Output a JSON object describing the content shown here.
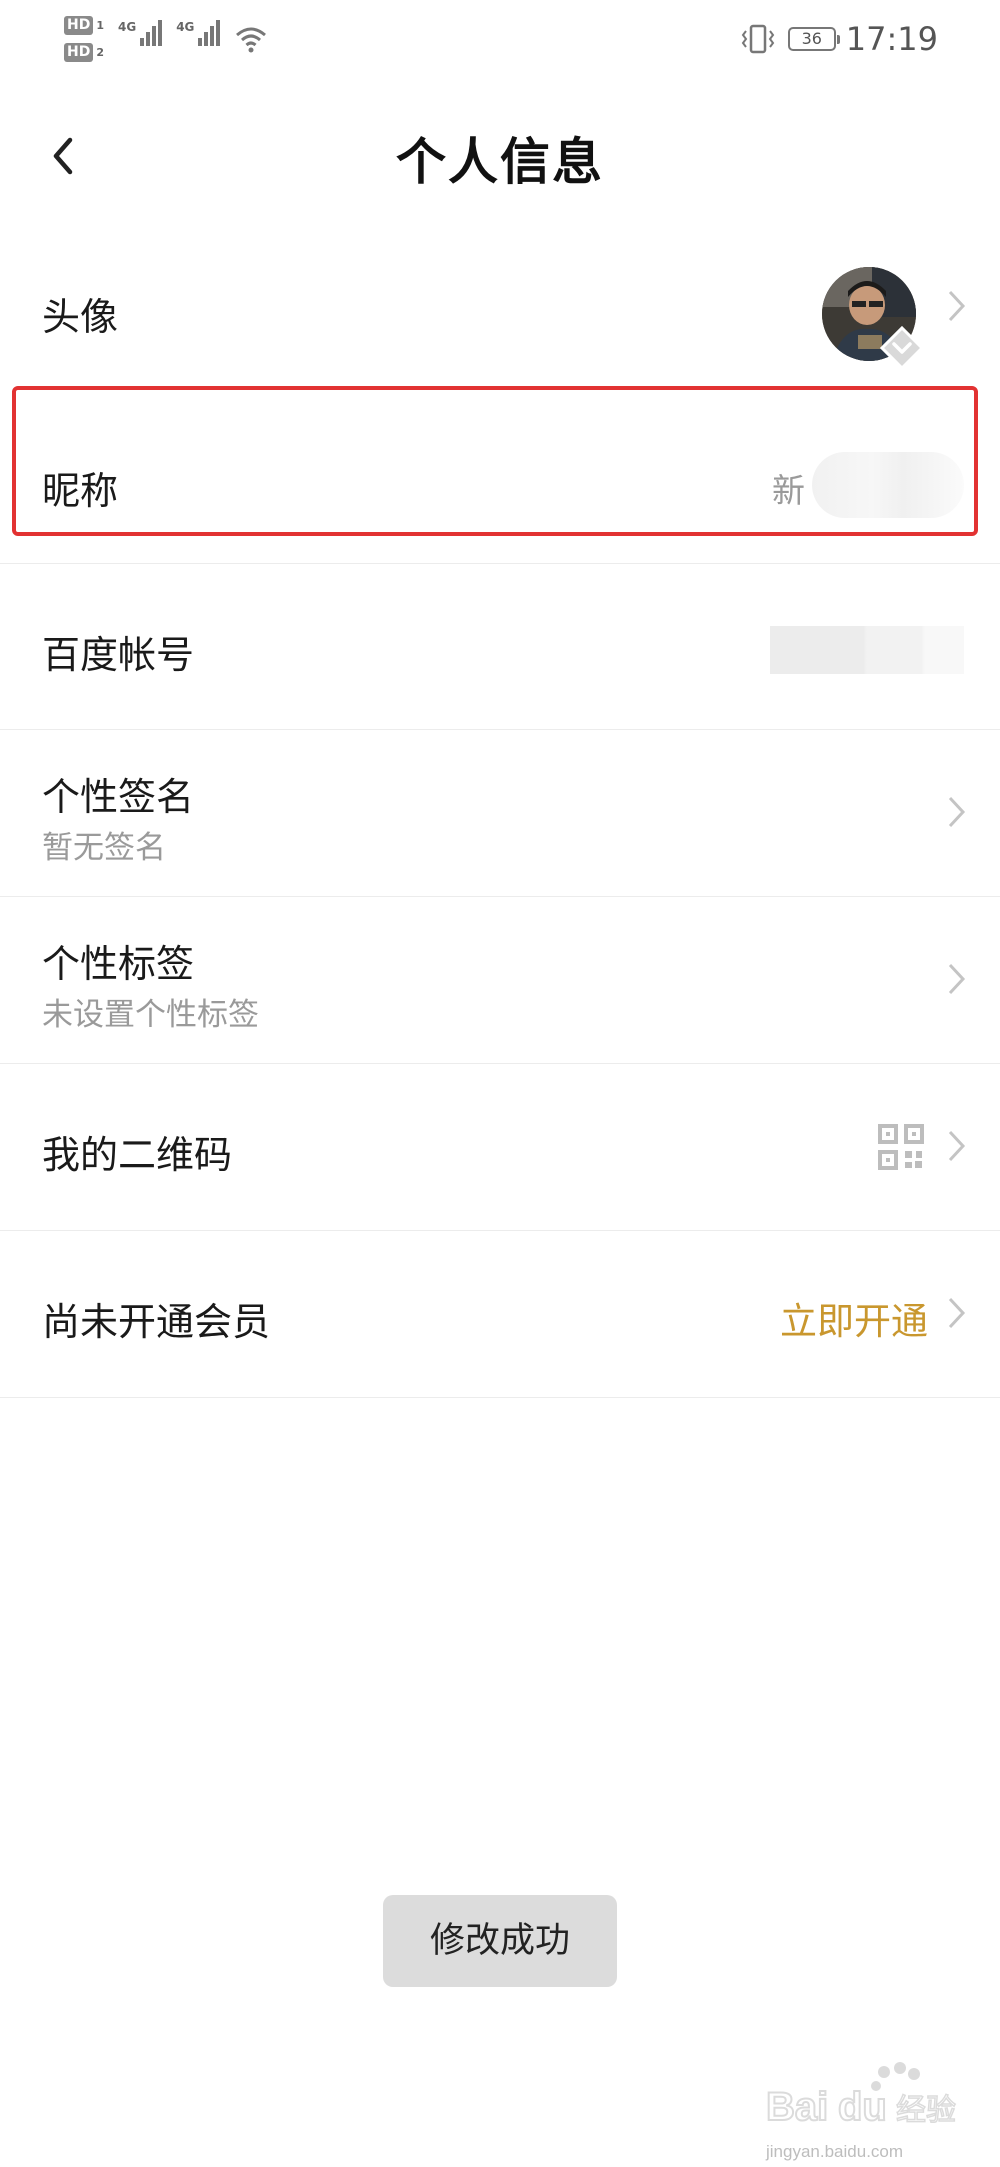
{
  "status_bar": {
    "sim1_label": "HD",
    "sim1_num": "1",
    "sim2_label": "HD",
    "sim2_num": "2",
    "network1": "4G",
    "network2": "4G",
    "battery": "36",
    "time": "17:19"
  },
  "header": {
    "title": "个人信息"
  },
  "rows": {
    "avatar": {
      "label": "头像"
    },
    "nickname": {
      "label": "昵称",
      "value_visible": "新"
    },
    "baidu_account": {
      "label": "百度帐号"
    },
    "signature": {
      "label": "个性签名",
      "sub": "暂无签名"
    },
    "tags": {
      "label": "个性标签",
      "sub": "未设置个性标签"
    },
    "qrcode": {
      "label": "我的二维码",
      "icon": "qr-code-icon"
    },
    "vip": {
      "label": "尚未开通会员",
      "action": "立即开通"
    }
  },
  "toast": "修改成功",
  "watermark": {
    "text": "jingyan.baidu.com",
    "logo": "Baidu经验"
  },
  "colors": {
    "accent_gold": "#c9972e",
    "highlight_red": "#e23232",
    "secondary_text": "#9a9a9a"
  }
}
